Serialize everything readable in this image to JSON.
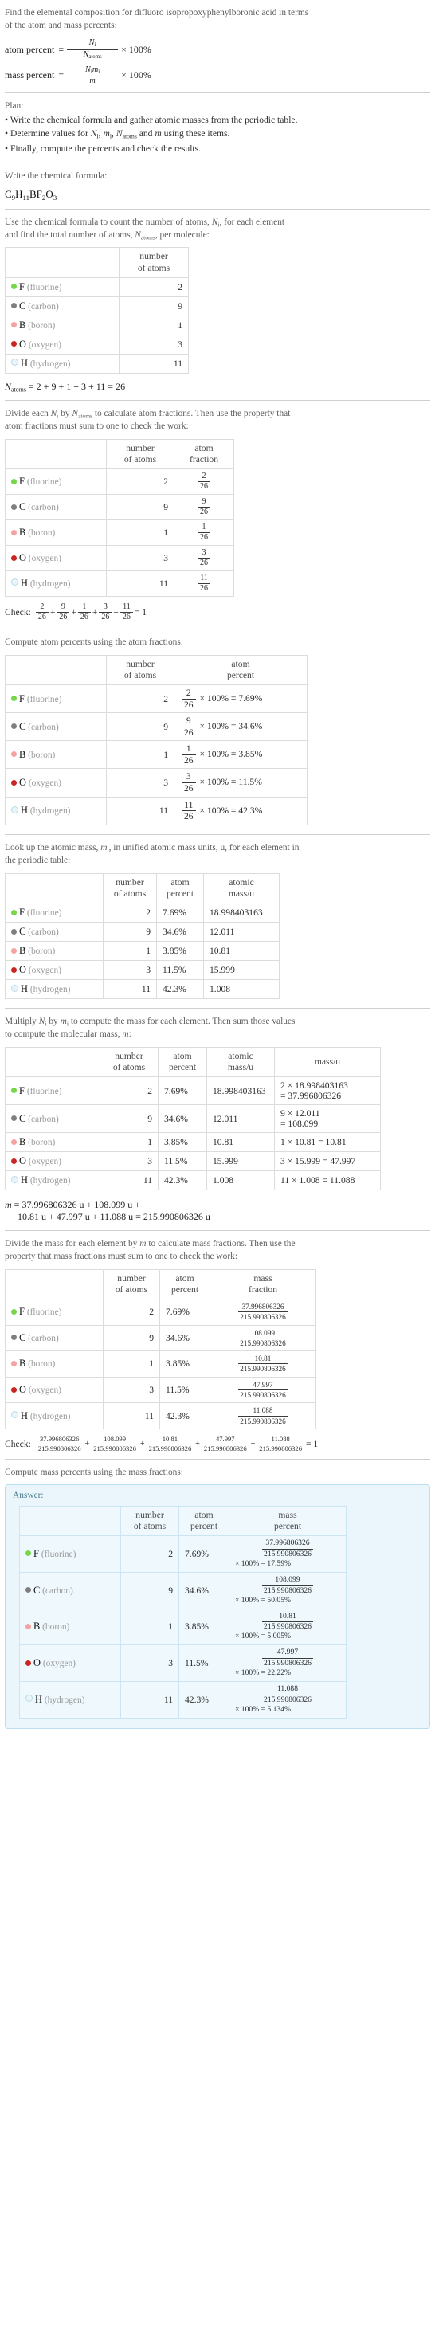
{
  "header": {
    "question_line1": "Find the elemental composition for difluoro isopropoxyphenylboronic acid in terms",
    "question_line2": "of the atom and mass percents:",
    "atom_percent_label": "atom percent",
    "mass_percent_label": "mass percent",
    "equals": "=",
    "times100": "× 100%",
    "Ni": "N",
    "i_sub": "i",
    "Natoms_sym": "N",
    "atoms_sub": "atoms",
    "mi": "m",
    "m": "m"
  },
  "plan": {
    "title": "Plan:",
    "bullets": [
      "Write the chemical formula and gather atomic masses from the periodic table.",
      "Determine values for Nᵢ, mᵢ, Nₐₜₒₘₛ and m using these items.",
      "Finally, compute the percents and check the results."
    ],
    "bullet2_parts": {
      "pre": "Determine values for ",
      "mid": " and ",
      "post": " using these items."
    }
  },
  "formula_section": {
    "prompt": "Write the chemical formula:",
    "formula_plain": "C9H11BF2O3",
    "formula_parts": [
      {
        "sym": "C",
        "sub": "9"
      },
      {
        "sym": "H",
        "sub": "11"
      },
      {
        "sym": "B",
        "sub": ""
      },
      {
        "sym": "F",
        "sub": "2"
      },
      {
        "sym": "O",
        "sub": "3"
      }
    ]
  },
  "count_section": {
    "prompt_line1": "Use the chemical formula to count the number of atoms, Nᵢ, for each element",
    "prompt_line2": "and find the total number of atoms, Nₐₜₒₘₛ, per molecule:",
    "headers": [
      "",
      "number of atoms"
    ],
    "header_lines": [
      [
        "",
        ""
      ],
      [
        "number",
        "of atoms"
      ]
    ],
    "total_label": "N",
    "total_sub": "atoms",
    "total_expr": "= 2 + 9 + 1 + 3 + 11 = 26"
  },
  "fraction_section": {
    "prompt_line1": "Divide each Nᵢ by Nₐₜₒₘₛ to calculate atom fractions. Then use the property that",
    "prompt_line2": "atom fractions must sum to one to check the work:",
    "header_lines": [
      [
        "",
        ""
      ],
      [
        "number",
        "of atoms"
      ],
      [
        "atom",
        "fraction"
      ]
    ],
    "check_label": "Check:",
    "check_terms": [
      "2",
      "9",
      "1",
      "3",
      "11"
    ],
    "check_den": "26",
    "check_result": "= 1"
  },
  "atom_percent_section": {
    "prompt": "Compute atom percents using the atom fractions:",
    "header_lines": [
      [
        "",
        ""
      ],
      [
        "number",
        "of atoms"
      ],
      [
        "atom",
        "percent"
      ]
    ],
    "times_100_text": "× 100% ="
  },
  "atomic_mass_section": {
    "prompt_line1": "Look up the atomic mass, mᵢ, in unified atomic mass units, u, for each element in",
    "prompt_line2": "the periodic table:",
    "header_lines": [
      [
        "",
        ""
      ],
      [
        "number",
        "of atoms"
      ],
      [
        "atom",
        "percent"
      ],
      [
        "atomic",
        "mass/u"
      ]
    ]
  },
  "mass_section": {
    "prompt_line1": "Multiply Nᵢ by mᵢ to compute the mass for each element. Then sum those values",
    "prompt_line2": "to compute the molecular mass, m:",
    "header_lines": [
      [
        "",
        ""
      ],
      [
        "number",
        "of atoms"
      ],
      [
        "atom",
        "percent"
      ],
      [
        "atomic",
        "mass/u"
      ],
      [
        "mass/u",
        ""
      ]
    ],
    "total_line1": "m = 37.996806326 u + 108.099 u +",
    "total_line2": "10.81 u + 47.997 u + 11.088 u = 215.990806326 u"
  },
  "mass_fraction_section": {
    "prompt_line1": "Divide the mass for each element by m to calculate mass fractions. Then use the",
    "prompt_line2": "property that mass fractions must sum to one to check the work:",
    "header_lines": [
      [
        "",
        ""
      ],
      [
        "number",
        "of atoms"
      ],
      [
        "atom",
        "percent"
      ],
      [
        "mass",
        "fraction"
      ]
    ],
    "check_label": "Check:",
    "check_den": "215.990806326",
    "check_nums": [
      "37.996806326",
      "108.099",
      "10.81",
      "47.997",
      "11.088"
    ],
    "check_result": "= 1"
  },
  "answer_section": {
    "prompt": "Compute mass percents using the mass fractions:",
    "answer_label": "Answer:",
    "header_lines": [
      [
        "",
        ""
      ],
      [
        "number",
        "of atoms"
      ],
      [
        "atom",
        "percent"
      ],
      [
        "mass",
        "percent"
      ]
    ],
    "denominator": "215.990806326",
    "times_100_text": "× 100% ="
  },
  "elements": [
    {
      "symbol": "F",
      "name": "(fluorine)",
      "color": "#78d64b",
      "hollow": false,
      "count": "2",
      "atom_fraction_num": "2",
      "atom_fraction_den": "26",
      "atom_percent": "7.69%",
      "atomic_mass": "18.998403163",
      "mass_expr": "2 × 18.998403163",
      "mass_expr_result": "= 37.996806326",
      "mass_expr_inline": "2 × 18.998403163 = 37.996806326",
      "mass_value": "37.996806326",
      "mass_percent": "17.59%"
    },
    {
      "symbol": "C",
      "name": "(carbon)",
      "color": "#7f7f7f",
      "hollow": false,
      "count": "9",
      "atom_fraction_num": "9",
      "atom_fraction_den": "26",
      "atom_percent": "34.6%",
      "atomic_mass": "12.011",
      "mass_expr": "9 × 12.011",
      "mass_expr_result": "= 108.099",
      "mass_expr_inline": "9 × 12.011 = 108.099",
      "mass_value": "108.099",
      "mass_percent": "50.05%"
    },
    {
      "symbol": "B",
      "name": "(boron)",
      "color": "#f4a2a2",
      "hollow": false,
      "count": "1",
      "atom_fraction_num": "1",
      "atom_fraction_den": "26",
      "atom_percent": "3.85%",
      "atomic_mass": "10.81",
      "mass_expr": "1 × 10.81 = 10.81",
      "mass_expr_result": "",
      "mass_expr_inline": "1 × 10.81 = 10.81",
      "mass_value": "10.81",
      "mass_percent": "5.005%"
    },
    {
      "symbol": "O",
      "name": "(oxygen)",
      "color": "#c9261f",
      "hollow": false,
      "count": "3",
      "atom_fraction_num": "3",
      "atom_fraction_den": "26",
      "atom_percent": "11.5%",
      "atomic_mass": "15.999",
      "mass_expr": "3 × 15.999 = 47.997",
      "mass_expr_result": "",
      "mass_expr_inline": "3 × 15.999 = 47.997",
      "mass_value": "47.997",
      "mass_percent": "22.22%"
    },
    {
      "symbol": "H",
      "name": "(hydrogen)",
      "color": "#e8f6fb",
      "hollow": true,
      "count": "11",
      "atom_fraction_num": "11",
      "atom_fraction_den": "26",
      "atom_percent": "42.3%",
      "atomic_mass": "1.008",
      "mass_expr": "11 × 1.008 = 11.088",
      "mass_expr_result": "",
      "mass_expr_inline": "11 × 1.008 = 11.088",
      "mass_value": "11.088",
      "mass_percent": "5.134%"
    }
  ]
}
